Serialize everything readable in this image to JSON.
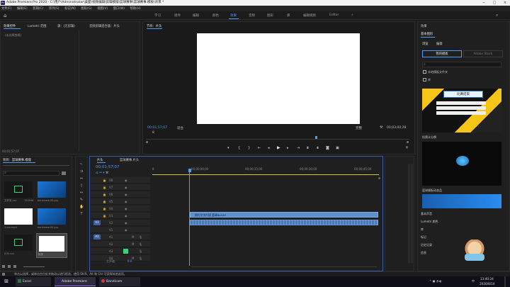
{
  "titlebar": {
    "app_icon": "Pr",
    "title": "Adobe Premiere Pro 2020 - C:\\用户\\Administrator\\桌面\\视频编辑\\剪辑模版\\篮球赛事\\篮球赛事.模板\\背景 *"
  },
  "menu": [
    "文件(F)",
    "编辑(E)",
    "剪辑(C)",
    "序列(S)",
    "标记(M)",
    "图形(G)",
    "视图(V)",
    "窗口(W)",
    "帮助(H)"
  ],
  "workspaces": [
    "学习",
    "组件",
    "编辑",
    "颜色",
    "效果",
    "音频",
    "图形",
    "库",
    "编辑视频",
    "Editor"
  ],
  "active_workspace_index": 4,
  "source_panel": {
    "tabs": [
      "效果控件",
      "Lumetri 范围",
      "源：(无剪辑)",
      "音频剪辑混合器：片头"
    ],
    "empty_text": "(未选择剪辑)",
    "timecode": "00;01;57;07"
  },
  "program_monitor": {
    "tab": "节目：片头",
    "timecode_current": "00;01;57;07",
    "fit_label": "适合",
    "quality_label": "完整",
    "timecode_total": "00;03;00;28",
    "marker_label": "8"
  },
  "project_panel": {
    "tabs": [
      "项目：篮球赛事.模版",
      "媒体浏览器",
      "库"
    ],
    "search_placeholder": "",
    "items": [
      {
        "name": "文件夹.csv",
        "meta": "152946"
      },
      {
        "name": "bankmew.00.jpg",
        "meta": "0x0:0"
      },
      {
        "name": "bankmew.00.jpg",
        "meta": "0x0:0"
      },
      {
        "name": "1.csv.mp4",
        "meta": "1:02:13"
      },
      {
        "name": "bankmew.00.jpg",
        "meta": "0x0:0"
      },
      {
        "name": "bankmew.00.jpg",
        "meta": "0x0:0"
      },
      {
        "name": "片头.csv",
        "meta": "R:5:00:"
      },
      {
        "name": "片头",
        "meta": ""
      }
    ]
  },
  "timeline": {
    "tabs": [
      "片头",
      "篮球赛事.片头"
    ],
    "timecode": "00;01;57;07",
    "ruler": [
      "00;00;00;00",
      "00;00;15;00",
      "00;00;30;00",
      "00;00;45;00"
    ],
    "video_tracks": [
      "V8",
      "V7",
      "V6",
      "V5",
      "V4",
      "V3",
      "V2",
      "V1"
    ],
    "audio_tracks": [
      "A1",
      "A2",
      "A3",
      "A4",
      "A5",
      "A6"
    ],
    "master_label": "主声道",
    "master_value": "0.0",
    "video_clip": "图片文字片段 篮球Bull.tif",
    "sync_labels": [
      "V1",
      "A1"
    ]
  },
  "essential_graphics": {
    "tab": "效果",
    "title": "基本图形",
    "subtabs": [
      "浏览",
      "编辑"
    ],
    "my_templates": "我的模板",
    "adobe_stock": "Adobe Stock",
    "search_placeholder": "",
    "checkbox1": "本地模板文件夹",
    "checkbox2": "库",
    "templates": [
      {
        "name": "比赛结束"
      },
      {
        "name": "投票计分牌"
      },
      {
        "name": "篮球模板动态品"
      }
    ],
    "bottom_items": [
      "基本声音",
      "Lumetri 颜色",
      "库",
      "标记",
      "历史记录",
      "信息"
    ],
    "preview_caption": "比赛结束",
    "preview2_caption": "篮球模版"
  },
  "status_bar": {
    "text": "单击以选择，或单击空白处并拖动以进行框选，使用 Shift、Alt 和 Ctrl 可获得其他选项。"
  },
  "taskbar": {
    "items": [
      "E",
      "Excel",
      "Adobe Premiere",
      "Bandicam"
    ],
    "time": "13:40:24",
    "date": "2020/8/14",
    "lang": "中"
  },
  "colors": {
    "accent": "#4a9eff",
    "pr_purple": "#2a1a5e",
    "clip_video": "#5b8fd0",
    "clip_audio": "#4a7ab8"
  }
}
